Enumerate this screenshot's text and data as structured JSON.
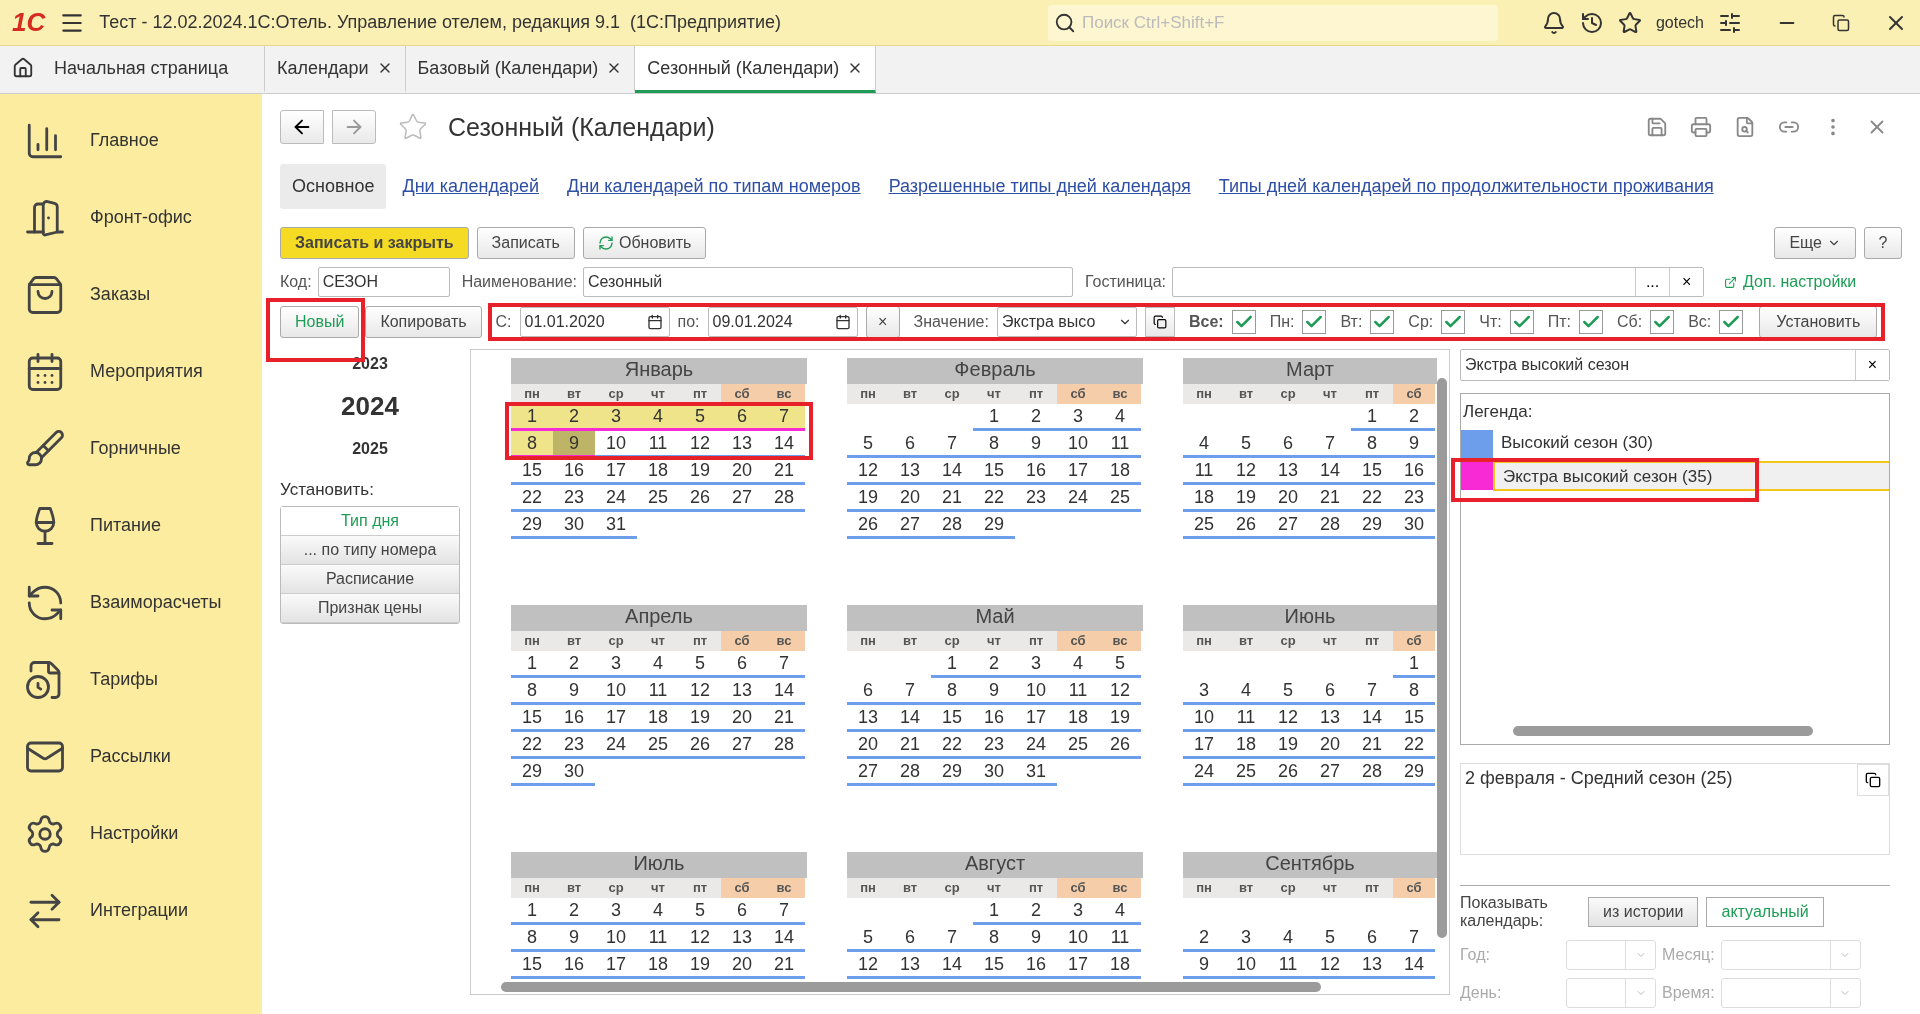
{
  "window": {
    "logo": "1С",
    "title": "Тест - 12.02.2024.1С:Отель. Управление отелем, редакция 9.1  (1С:Предприятие)",
    "search": {
      "placeholder": "Поиск Ctrl+Shift+F"
    },
    "user": "gotech"
  },
  "tabs": [
    {
      "label": "Начальная страница",
      "kind": "home",
      "selected": false
    },
    {
      "label": "Календари",
      "kind": "doc",
      "selected": false
    },
    {
      "label": "Базовый (Календари)",
      "kind": "doc",
      "selected": false
    },
    {
      "label": "Сезонный (Календари)",
      "kind": "doc",
      "selected": true
    }
  ],
  "sidebar": {
    "items": [
      {
        "label": "Главное",
        "kind": "chart"
      },
      {
        "label": "Фронт-офис",
        "kind": "door"
      },
      {
        "label": "Заказы",
        "kind": "bag"
      },
      {
        "label": "Мероприятия",
        "kind": "calendar"
      },
      {
        "label": "Горничные",
        "kind": "brush"
      },
      {
        "label": "Питание",
        "kind": "wine"
      },
      {
        "label": "Взаиморасчеты",
        "kind": "cycle"
      },
      {
        "label": "Тарифы",
        "kind": "file"
      },
      {
        "label": "Рассылки",
        "kind": "mail"
      },
      {
        "label": "Настройки",
        "kind": "gear"
      },
      {
        "label": "Интеграции",
        "kind": "arrows"
      }
    ]
  },
  "form": {
    "title": "Сезонный (Календари)",
    "nav": [
      {
        "label": "Основное",
        "selected": true
      },
      {
        "label": "Дни календарей",
        "selected": false
      },
      {
        "label": "Дни календарей по типам номеров",
        "selected": false
      },
      {
        "label": "Разрешенные типы дней календаря",
        "selected": false
      },
      {
        "label": "Типы дней календарей по продолжительности проживания",
        "selected": false
      }
    ],
    "buttons": [
      {
        "label": "Записать и закрыть",
        "kind": "primary"
      },
      {
        "label": "Записать",
        "kind": "plain"
      },
      {
        "label": "Обновить",
        "kind": "refresh"
      }
    ],
    "more": "Еще",
    "help": "?",
    "fields": [
      {
        "label": "Код:",
        "value": "СЕЗОН",
        "kind": "code"
      },
      {
        "label": "Наименование:",
        "value": "Сезонный",
        "kind": "name"
      },
      {
        "label": "Гостиница:",
        "kind": "hotel",
        "choose": "...",
        "clear": "×"
      }
    ],
    "extra_link": "Доп. настройки",
    "new_button": {
      "label": "Новый",
      "highlighted": true
    },
    "copy_button": "Копировать",
    "filter": {
      "highlighted": true,
      "from_label": "С:",
      "from": "01.01.2020",
      "to_label": "по:",
      "to": "09.01.2024",
      "clear": "×",
      "value_label": "Значение:",
      "value": "Экстра высо",
      "checks": [
        {
          "label": "Все:",
          "kind": "all",
          "checked": true
        },
        {
          "label": "Пн:",
          "kind": "day",
          "checked": true
        },
        {
          "label": "Вт:",
          "kind": "day",
          "checked": true
        },
        {
          "label": "Ср:",
          "kind": "day",
          "checked": true
        },
        {
          "label": "Чт:",
          "kind": "day",
          "checked": true
        },
        {
          "label": "Пт:",
          "kind": "day",
          "checked": true
        },
        {
          "label": "Сб:",
          "kind": "day",
          "checked": true
        },
        {
          "label": "Вс:",
          "kind": "day",
          "checked": true
        }
      ],
      "apply": "Установить"
    }
  },
  "years": [
    {
      "label": "2023",
      "selected": false
    },
    {
      "label": "2024",
      "selected": true
    },
    {
      "label": "2025",
      "selected": false
    }
  ],
  "set_label": "Установить:",
  "set_buttons": [
    {
      "label": "Тип дня",
      "selected": true
    },
    {
      "label": "... по типу номера",
      "selected": false
    },
    {
      "label": "Расписание",
      "selected": false
    },
    {
      "label": "Признак цены",
      "selected": false
    }
  ],
  "calendar": {
    "months": [
      {
        "name": "Январь",
        "color": "#6d9eeb",
        "weekdays": [
          {
            "label": "пн",
            "weekend": false
          },
          {
            "label": "вт",
            "weekend": false
          },
          {
            "label": "ср",
            "weekend": false
          },
          {
            "label": "чт",
            "weekend": false
          },
          {
            "label": "пт",
            "weekend": false
          },
          {
            "label": "сб",
            "weekend": true
          },
          {
            "label": "вс",
            "weekend": true
          }
        ],
        "weeks": [
          {
            "highlighted": true,
            "days": [
              {
                "text": "1",
                "color": "#f72ad6",
                "in_range": true,
                "selected": false
              },
              {
                "text": "2",
                "color": "#f72ad6",
                "in_range": true,
                "selected": false
              },
              {
                "text": "3",
                "color": "#f72ad6",
                "in_range": true,
                "selected": false
              },
              {
                "text": "4",
                "color": "#f72ad6",
                "in_range": true,
                "selected": false
              },
              {
                "text": "5",
                "color": "#f72ad6",
                "in_range": true,
                "selected": false
              },
              {
                "text": "6",
                "color": "#f72ad6",
                "in_range": true,
                "selected": false
              },
              {
                "text": "7",
                "color": "#f72ad6",
                "in_range": true,
                "selected": false
              }
            ]
          },
          {
            "highlighted": true,
            "days": [
              {
                "text": "8",
                "color": "#f72ad6",
                "in_range": true,
                "selected": false
              },
              {
                "text": "9",
                "color": "#f72ad6",
                "in_range": true,
                "selected": true
              },
              {
                "text": "10",
                "color": "#6d9eeb",
                "in_range": false,
                "selected": false
              },
              {
                "text": "11",
                "color": "#6d9eeb",
                "in_range": false,
                "selected": false
              },
              {
                "text": "12",
                "color": "#6d9eeb",
                "in_range": false,
                "selected": false
              },
              {
                "text": "13",
                "color": "#6d9eeb",
                "in_range": false,
                "selected": false
              },
              {
                "text": "14",
                "color": "#6d9eeb",
                "in_range": false,
                "selected": false
              }
            ]
          },
          {
            "days": [
              "15",
              "16",
              "17",
              "18",
              "19",
              "20",
              "21"
            ]
          },
          {
            "days": [
              "22",
              "23",
              "24",
              "25",
              "26",
              "27",
              "28"
            ]
          },
          {
            "days": [
              "29",
              "30",
              "31"
            ]
          }
        ]
      },
      {
        "name": "Февраль",
        "color": "#6d9eeb",
        "weekdays": [
          {
            "label": "пн",
            "weekend": false
          },
          {
            "label": "вт",
            "weekend": false
          },
          {
            "label": "ср",
            "weekend": false
          },
          {
            "label": "чт",
            "weekend": false
          },
          {
            "label": "пт",
            "weekend": false
          },
          {
            "label": "сб",
            "weekend": true
          },
          {
            "label": "вс",
            "weekend": true
          }
        ],
        "weeks": [
          {
            "right_aligned": true,
            "days": [
              "1",
              "2",
              "3",
              "4"
            ]
          },
          {
            "days": [
              "5",
              "6",
              "7",
              "8",
              "9",
              "10",
              "11"
            ]
          },
          {
            "days": [
              "12",
              "13",
              "14",
              "15",
              "16",
              "17",
              "18"
            ]
          },
          {
            "days": [
              "19",
              "20",
              "21",
              "22",
              "23",
              "24",
              "25"
            ]
          },
          {
            "days": [
              "26",
              "27",
              "28",
              "29"
            ]
          }
        ]
      },
      {
        "name": "Март",
        "color": "#6d9eeb",
        "weekdays": [
          {
            "label": "пн",
            "weekend": false
          },
          {
            "label": "вт",
            "weekend": false
          },
          {
            "label": "ср",
            "weekend": false
          },
          {
            "label": "чт",
            "weekend": false
          },
          {
            "label": "пт",
            "weekend": false
          },
          {
            "label": "сб",
            "weekend": true
          }
        ],
        "weeks": [
          {
            "right_aligned": true,
            "days": [
              "1",
              "2"
            ]
          },
          {
            "days": [
              "4",
              "5",
              "6",
              "7",
              "8",
              "9"
            ]
          },
          {
            "days": [
              "11",
              "12",
              "13",
              "14",
              "15",
              "16"
            ]
          },
          {
            "days": [
              "18",
              "19",
              "20",
              "21",
              "22",
              "23"
            ]
          },
          {
            "days": [
              "25",
              "26",
              "27",
              "28",
              "29",
              "30"
            ]
          }
        ]
      },
      {
        "name": "Апрель",
        "color": "#6d9eeb",
        "weekdays": [
          {
            "label": "пн",
            "weekend": false
          },
          {
            "label": "вт",
            "weekend": false
          },
          {
            "label": "ср",
            "weekend": false
          },
          {
            "label": "чт",
            "weekend": false
          },
          {
            "label": "пт",
            "weekend": false
          },
          {
            "label": "сб",
            "weekend": true
          },
          {
            "label": "вс",
            "weekend": true
          }
        ],
        "weeks": [
          {
            "days": [
              "1",
              "2",
              "3",
              "4",
              "5",
              "6",
              "7"
            ]
          },
          {
            "days": [
              "8",
              "9",
              "10",
              "11",
              "12",
              "13",
              "14"
            ]
          },
          {
            "days": [
              "15",
              "16",
              "17",
              "18",
              "19",
              "20",
              "21"
            ]
          },
          {
            "days": [
              "22",
              "23",
              "24",
              "25",
              "26",
              "27",
              "28"
            ]
          },
          {
            "days": [
              "29",
              "30"
            ]
          }
        ]
      },
      {
        "name": "Май",
        "color": "#6d9eeb",
        "weekdays": [
          {
            "label": "пн",
            "weekend": false
          },
          {
            "label": "вт",
            "weekend": false
          },
          {
            "label": "ср",
            "weekend": false
          },
          {
            "label": "чт",
            "weekend": false
          },
          {
            "label": "пт",
            "weekend": false
          },
          {
            "label": "сб",
            "weekend": true
          },
          {
            "label": "вс",
            "weekend": true
          }
        ],
        "weeks": [
          {
            "right_aligned": true,
            "days": [
              "1",
              "2",
              "3",
              "4",
              "5"
            ]
          },
          {
            "days": [
              "6",
              "7",
              "8",
              "9",
              "10",
              "11",
              "12"
            ]
          },
          {
            "days": [
              "13",
              "14",
              "15",
              "16",
              "17",
              "18",
              "19"
            ]
          },
          {
            "days": [
              "20",
              "21",
              "22",
              "23",
              "24",
              "25",
              "26"
            ]
          },
          {
            "days": [
              "27",
              "28",
              "29",
              "30",
              "31"
            ]
          }
        ]
      },
      {
        "name": "Июнь",
        "color": "#6d9eeb",
        "weekdays": [
          {
            "label": "пн",
            "weekend": false
          },
          {
            "label": "вт",
            "weekend": false
          },
          {
            "label": "ср",
            "weekend": false
          },
          {
            "label": "чт",
            "weekend": false
          },
          {
            "label": "пт",
            "weekend": false
          },
          {
            "label": "сб",
            "weekend": true
          }
        ],
        "weeks": [
          {
            "right_aligned": true,
            "days": [
              "1"
            ]
          },
          {
            "days": [
              "3",
              "4",
              "5",
              "6",
              "7",
              "8"
            ]
          },
          {
            "days": [
              "10",
              "11",
              "12",
              "13",
              "14",
              "15"
            ]
          },
          {
            "days": [
              "17",
              "18",
              "19",
              "20",
              "21",
              "22"
            ]
          },
          {
            "days": [
              "24",
              "25",
              "26",
              "27",
              "28",
              "29"
            ]
          }
        ]
      },
      {
        "name": "Июль",
        "color": "#6d9eeb",
        "weekdays": [
          {
            "label": "пн",
            "weekend": false
          },
          {
            "label": "вт",
            "weekend": false
          },
          {
            "label": "ср",
            "weekend": false
          },
          {
            "label": "чт",
            "weekend": false
          },
          {
            "label": "пт",
            "weekend": false
          },
          {
            "label": "сб",
            "weekend": true
          },
          {
            "label": "вс",
            "weekend": true
          }
        ],
        "weeks": [
          {
            "days": [
              "1",
              "2",
              "3",
              "4",
              "5",
              "6",
              "7"
            ]
          },
          {
            "days": [
              "8",
              "9",
              "10",
              "11",
              "12",
              "13",
              "14"
            ]
          },
          {
            "days": [
              "15",
              "16",
              "17",
              "18",
              "19",
              "20",
              "21"
            ]
          }
        ]
      },
      {
        "name": "Август",
        "color": "#6d9eeb",
        "weekdays": [
          {
            "label": "пн",
            "weekend": false
          },
          {
            "label": "вт",
            "weekend": false
          },
          {
            "label": "ср",
            "weekend": false
          },
          {
            "label": "чт",
            "weekend": false
          },
          {
            "label": "пт",
            "weekend": false
          },
          {
            "label": "сб",
            "weekend": true
          },
          {
            "label": "вс",
            "weekend": true
          }
        ],
        "weeks": [
          {
            "right_aligned": true,
            "days": [
              "1",
              "2",
              "3",
              "4"
            ]
          },
          {
            "days": [
              "5",
              "6",
              "7",
              "8",
              "9",
              "10",
              "11"
            ]
          },
          {
            "days": [
              "12",
              "13",
              "14",
              "15",
              "16",
              "17",
              "18"
            ]
          }
        ]
      },
      {
        "name": "Сентябрь",
        "color": "#6d9eeb",
        "blank_first_row": true,
        "weekdays": [
          {
            "label": "пн",
            "weekend": false
          },
          {
            "label": "вт",
            "weekend": false
          },
          {
            "label": "ср",
            "weekend": false
          },
          {
            "label": "чт",
            "weekend": false
          },
          {
            "label": "пт",
            "weekend": false
          },
          {
            "label": "сб",
            "weekend": true
          }
        ],
        "weeks": [
          {
            "days": [
              "2",
              "3",
              "4",
              "5",
              "6",
              "7"
            ]
          },
          {
            "days": [
              "9",
              "10",
              "11",
              "12",
              "13",
              "14"
            ]
          }
        ]
      }
    ]
  },
  "legend_panel": {
    "search": "Экстра высокий сезон",
    "clear": "×",
    "title": "Легенда:",
    "items": [
      {
        "label": "Высокий сезон (30)",
        "color": "#6d9eeb",
        "selected": false,
        "highlighted": false
      },
      {
        "label": "Экстра высокий сезон (35)",
        "color": "#f72ad6",
        "selected": true,
        "highlighted": true
      }
    ],
    "info": "2 февраля - Средний сезон (25)",
    "show_label": "Показывать календарь:",
    "show_options": [
      {
        "label": "из истории",
        "selected": false
      },
      {
        "label": "актуальный",
        "selected": true
      }
    ],
    "selects": [
      {
        "label": "Год:",
        "disabled": true
      },
      {
        "label": "Месяц:",
        "disabled": true
      },
      {
        "label": "День:",
        "disabled": true
      },
      {
        "label": "Время:",
        "disabled": true
      }
    ]
  }
}
